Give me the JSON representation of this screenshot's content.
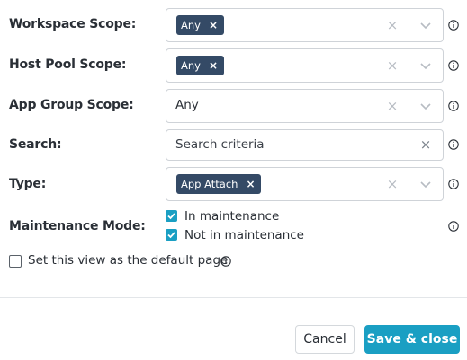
{
  "filters": {
    "workspace_scope": {
      "label": "Workspace Scope:",
      "chip": "Any",
      "chip_remove": "×"
    },
    "host_pool_scope": {
      "label": "Host Pool Scope:",
      "chip": "Any",
      "chip_remove": "×"
    },
    "app_group_scope": {
      "label": "App Group Scope:",
      "value": "Any"
    },
    "search": {
      "label": "Search:",
      "placeholder": "Search criteria",
      "clear": "×"
    },
    "type": {
      "label": "Type:",
      "chip": "App Attach",
      "chip_remove": "×"
    },
    "maintenance_mode": {
      "label": "Maintenance Mode:",
      "options": [
        {
          "label": "In maintenance",
          "checked": true
        },
        {
          "label": "Not in maintenance",
          "checked": true
        }
      ]
    }
  },
  "default_view": {
    "label": "Set this view as the default page",
    "checked": false
  },
  "common": {
    "clear": "×"
  },
  "buttons": {
    "cancel": "Cancel",
    "save_close": "Save & close"
  },
  "colors": {
    "accent": "#1a9fc3",
    "chip_bg": "#344a66",
    "border": "#cfd3d8"
  },
  "icons": {
    "info": "info-icon",
    "chevron": "chevron-down-icon",
    "clear": "close-icon",
    "check": "checkmark-icon"
  }
}
